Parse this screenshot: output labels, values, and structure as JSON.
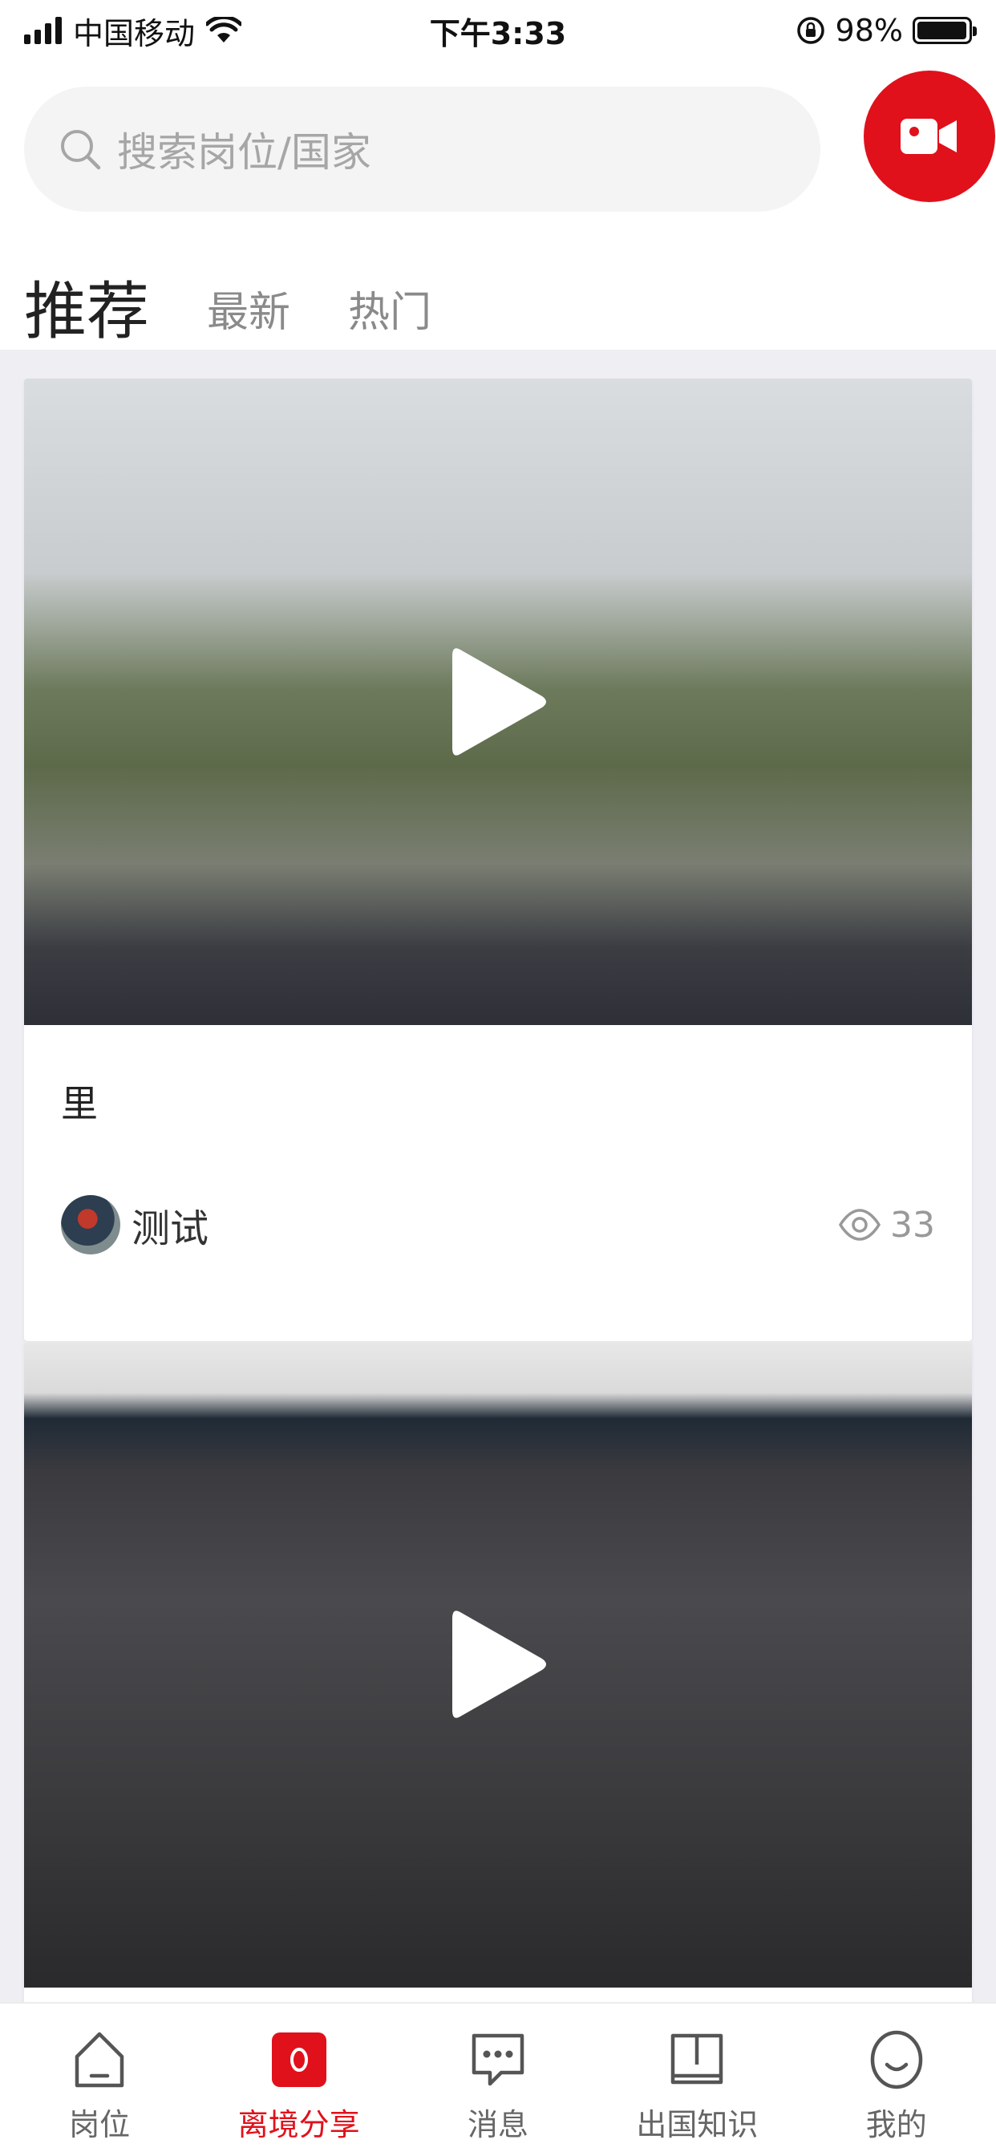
{
  "status_bar": {
    "carrier": "中国移动",
    "time": "下午3:33",
    "battery_percent": "98%",
    "battery_level": 0.98
  },
  "search": {
    "placeholder": "搜索岗位/国家",
    "camera_icon": "video-camera-icon",
    "accent_color": "#e0111b"
  },
  "tabs": [
    {
      "label": "推荐",
      "active": true
    },
    {
      "label": "最新",
      "active": false
    },
    {
      "label": "热门",
      "active": false
    }
  ],
  "posts": [
    {
      "title": "里",
      "author": "测试",
      "views": "33",
      "media": "video"
    },
    {
      "title": "",
      "author": "",
      "views": "",
      "media": "video"
    }
  ],
  "tabbar": {
    "items": [
      {
        "label": "岗位",
        "icon": "home-icon",
        "active": false
      },
      {
        "label": "离境分享",
        "icon": "share-icon",
        "active": true
      },
      {
        "label": "消息",
        "icon": "message-icon",
        "active": false
      },
      {
        "label": "出国知识",
        "icon": "book-icon",
        "active": false
      },
      {
        "label": "我的",
        "icon": "profile-icon",
        "active": false
      }
    ]
  }
}
